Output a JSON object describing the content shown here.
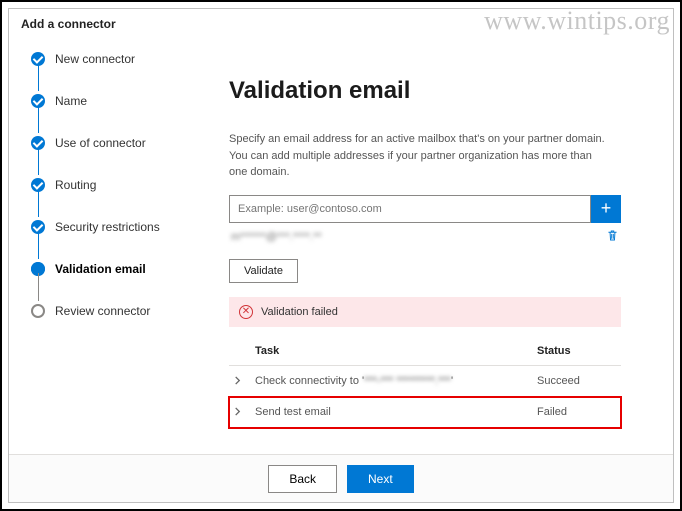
{
  "header": {
    "title": "Add a connector"
  },
  "watermark": "www.wintips.org",
  "nav": {
    "steps": [
      {
        "label": "New connector",
        "state": "done"
      },
      {
        "label": "Name",
        "state": "done"
      },
      {
        "label": "Use of connector",
        "state": "done"
      },
      {
        "label": "Routing",
        "state": "done"
      },
      {
        "label": "Security restrictions",
        "state": "done"
      },
      {
        "label": "Validation email",
        "state": "current"
      },
      {
        "label": "Review connector",
        "state": "pending"
      }
    ]
  },
  "main": {
    "heading": "Validation email",
    "description": "Specify an email address for an active mailbox that's on your partner domain. You can add multiple addresses if your partner organization has more than one domain.",
    "input_placeholder": "Example: user@contoso.com",
    "added_email": "m******@***.****.**",
    "validate_label": "Validate",
    "alert_text": "Validation failed",
    "table": {
      "head_task": "Task",
      "head_status": "Status",
      "rows": [
        {
          "task_prefix": "Check connectivity to '",
          "task_blur": "***-*** *********.***",
          "task_suffix": "'",
          "status": "Succeed"
        },
        {
          "task_prefix": "Send test email",
          "task_blur": "",
          "task_suffix": "",
          "status": "Failed"
        }
      ]
    }
  },
  "footer": {
    "back": "Back",
    "next": "Next"
  }
}
